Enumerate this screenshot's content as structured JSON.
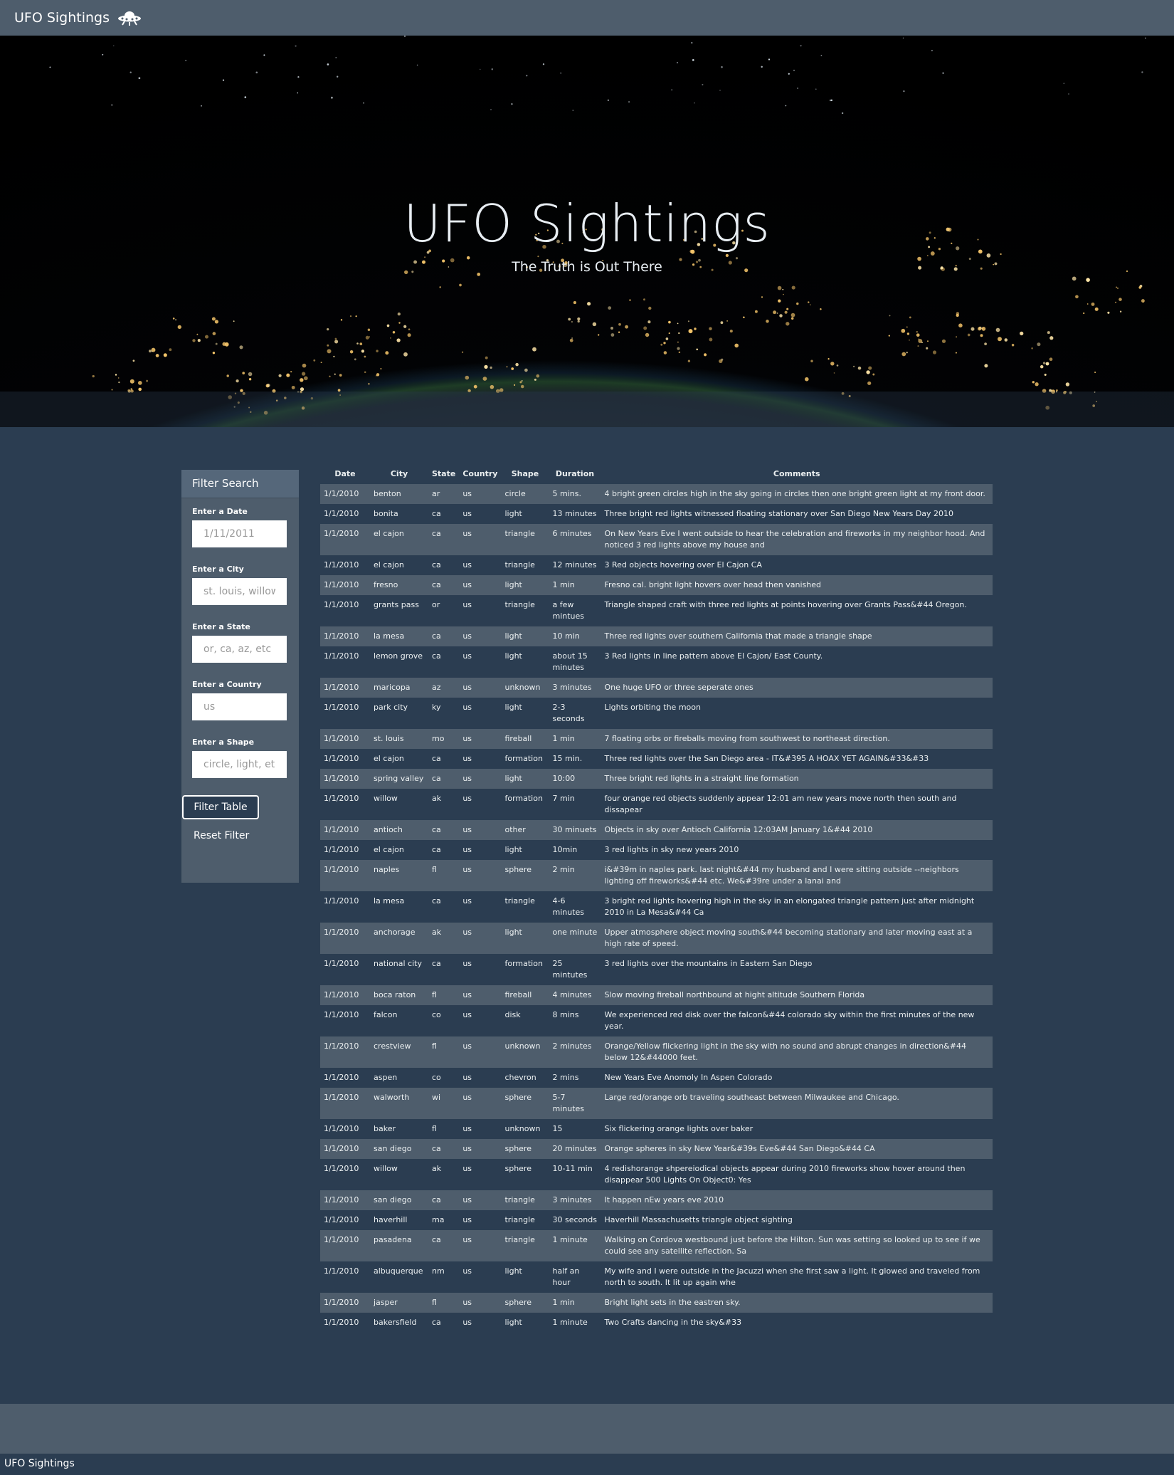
{
  "navbar": {
    "brand": "UFO Sightings",
    "logo_icon": "ufo-icon"
  },
  "hero": {
    "title": "UFO Sightings",
    "subtitle": "The Truth is Out There"
  },
  "sidebar": {
    "title": "Filter Search",
    "filters": [
      {
        "label": "Enter a Date",
        "placeholder": "1/11/2011",
        "value": ""
      },
      {
        "label": "Enter a City",
        "placeholder": "st. louis, willow",
        "value": ""
      },
      {
        "label": "Enter a State",
        "placeholder": "or, ca, az, etc",
        "value": ""
      },
      {
        "label": "Enter a Country",
        "placeholder": "us",
        "value": ""
      },
      {
        "label": "Enter a Shape",
        "placeholder": "circle, light, etc",
        "value": ""
      }
    ],
    "filter_button": "Filter Table",
    "reset_button": "Reset Filter"
  },
  "table": {
    "headers": [
      "Date",
      "City",
      "State",
      "Country",
      "Shape",
      "Duration",
      "Comments"
    ],
    "rows": [
      [
        "1/1/2010",
        "benton",
        "ar",
        "us",
        "circle",
        "5 mins.",
        "4 bright green circles high in the sky going in circles then one bright green light at my front door."
      ],
      [
        "1/1/2010",
        "bonita",
        "ca",
        "us",
        "light",
        "13 minutes",
        "Three bright red lights witnessed floating stationary over San Diego New Years Day 2010"
      ],
      [
        "1/1/2010",
        "el cajon",
        "ca",
        "us",
        "triangle",
        "6 minutes",
        "On New Years Eve I went outside to hear the celebration and fireworks in my neighbor hood. And noticed 3 red lights above my house and"
      ],
      [
        "1/1/2010",
        "el cajon",
        "ca",
        "us",
        "triangle",
        "12 minutes",
        "3 Red objects hovering over El Cajon CA"
      ],
      [
        "1/1/2010",
        "fresno",
        "ca",
        "us",
        "light",
        "1 min",
        "Fresno cal. bright light hovers over head then vanished"
      ],
      [
        "1/1/2010",
        "grants pass",
        "or",
        "us",
        "triangle",
        "a few mintues",
        "Triangle shaped craft with three red lights at points hovering over Grants Pass&#44 Oregon."
      ],
      [
        "1/1/2010",
        "la mesa",
        "ca",
        "us",
        "light",
        "10 min",
        "Three red lights over southern California that made a triangle shape"
      ],
      [
        "1/1/2010",
        "lemon grove",
        "ca",
        "us",
        "light",
        "about 15 minutes",
        "3 Red lights in line pattern above El Cajon/ East County."
      ],
      [
        "1/1/2010",
        "maricopa",
        "az",
        "us",
        "unknown",
        "3 minutes",
        "One huge UFO or three seperate ones"
      ],
      [
        "1/1/2010",
        "park city",
        "ky",
        "us",
        "light",
        "2-3 seconds",
        "Lights orbiting the moon"
      ],
      [
        "1/1/2010",
        "st. louis",
        "mo",
        "us",
        "fireball",
        "1 min",
        "7 floating orbs or fireballs moving from southwest to northeast direction."
      ],
      [
        "1/1/2010",
        "el cajon",
        "ca",
        "us",
        "formation",
        "15 min.",
        "Three red lights over the San Diego area - IT&#395 A HOAX YET AGAIN&#33&#33"
      ],
      [
        "1/1/2010",
        "spring valley",
        "ca",
        "us",
        "light",
        "10:00",
        "Three bright red lights in a straight line formation"
      ],
      [
        "1/1/2010",
        "willow",
        "ak",
        "us",
        "formation",
        "7 min",
        "four orange red objects suddenly appear 12:01 am new years move north then south and dissapear"
      ],
      [
        "1/1/2010",
        "antioch",
        "ca",
        "us",
        "other",
        "30 minuets",
        "Objects in sky over Antioch California 12:03AM January 1&#44 2010"
      ],
      [
        "1/1/2010",
        "el cajon",
        "ca",
        "us",
        "light",
        "10min",
        "3 red lights in sky new years 2010"
      ],
      [
        "1/1/2010",
        "naples",
        "fl",
        "us",
        "sphere",
        "2 min",
        "i&#39m in naples park. last night&#44 my husband and I were sitting outside --neighbors lighting off fireworks&#44 etc. We&#39re under a lanai and"
      ],
      [
        "1/1/2010",
        "la mesa",
        "ca",
        "us",
        "triangle",
        "4-6 minutes",
        "3 bright red lights hovering high in the sky in an elongated triangle pattern just after midnight 2010 in La Mesa&#44 Ca"
      ],
      [
        "1/1/2010",
        "anchorage",
        "ak",
        "us",
        "light",
        "one minute",
        "Upper atmosphere object moving south&#44 becoming stationary and later moving east at a high rate of speed."
      ],
      [
        "1/1/2010",
        "national city",
        "ca",
        "us",
        "formation",
        "25 mintutes",
        "3 red lights over the mountains in Eastern San Diego"
      ],
      [
        "1/1/2010",
        "boca raton",
        "fl",
        "us",
        "fireball",
        "4 minutes",
        "Slow moving fireball northbound at hight altitude Southern Florida"
      ],
      [
        "1/1/2010",
        "falcon",
        "co",
        "us",
        "disk",
        "8 mins",
        "We experienced red disk over the falcon&#44 colorado sky within the first minutes of the new year."
      ],
      [
        "1/1/2010",
        "crestview",
        "fl",
        "us",
        "unknown",
        "2 minutes",
        "Orange/Yellow flickering light in the sky with no sound and abrupt changes in direction&#44 below 12&#44000 feet."
      ],
      [
        "1/1/2010",
        "aspen",
        "co",
        "us",
        "chevron",
        "2 mins",
        "New Years Eve Anomoly In Aspen Colorado"
      ],
      [
        "1/1/2010",
        "walworth",
        "wi",
        "us",
        "sphere",
        "5-7 minutes",
        "Large red/orange orb traveling southeast between Milwaukee and Chicago."
      ],
      [
        "1/1/2010",
        "baker",
        "fl",
        "us",
        "unknown",
        "15",
        "Six flickering orange lights over baker"
      ],
      [
        "1/1/2010",
        "san diego",
        "ca",
        "us",
        "sphere",
        "20 minutes",
        "Orange spheres in sky New Year&#39s Eve&#44 San Diego&#44 CA"
      ],
      [
        "1/1/2010",
        "willow",
        "ak",
        "us",
        "sphere",
        "10-11 min",
        "4 redishorange shpereiodical objects appear during 2010 fireworks show hover around then disappear 500 Lights On Object0: Yes"
      ],
      [
        "1/1/2010",
        "san diego",
        "ca",
        "us",
        "triangle",
        "3 minutes",
        "It happen nEw years eve 2010"
      ],
      [
        "1/1/2010",
        "haverhill",
        "ma",
        "us",
        "triangle",
        "30 seconds",
        "Haverhill Massachusetts triangle object sighting"
      ],
      [
        "1/1/2010",
        "pasadena",
        "ca",
        "us",
        "triangle",
        "1 minute",
        "Walking on Cordova westbound just before the Hilton. Sun was setting so looked up to see if we could see any satellite reflection. Sa"
      ],
      [
        "1/1/2010",
        "albuquerque",
        "nm",
        "us",
        "light",
        "half an hour",
        "My wife and I were outside in the Jacuzzi when she first saw a light. It glowed and traveled from north to south. It lit up again whe"
      ],
      [
        "1/1/2010",
        "jasper",
        "fl",
        "us",
        "sphere",
        "1 min",
        "Bright light sets in the eastren sky."
      ],
      [
        "1/1/2010",
        "bakersfield",
        "ca",
        "us",
        "light",
        "1 minute",
        "Two Crafts dancing in the sky&#33"
      ]
    ]
  },
  "footer": {
    "text": "UFO Sightings"
  }
}
